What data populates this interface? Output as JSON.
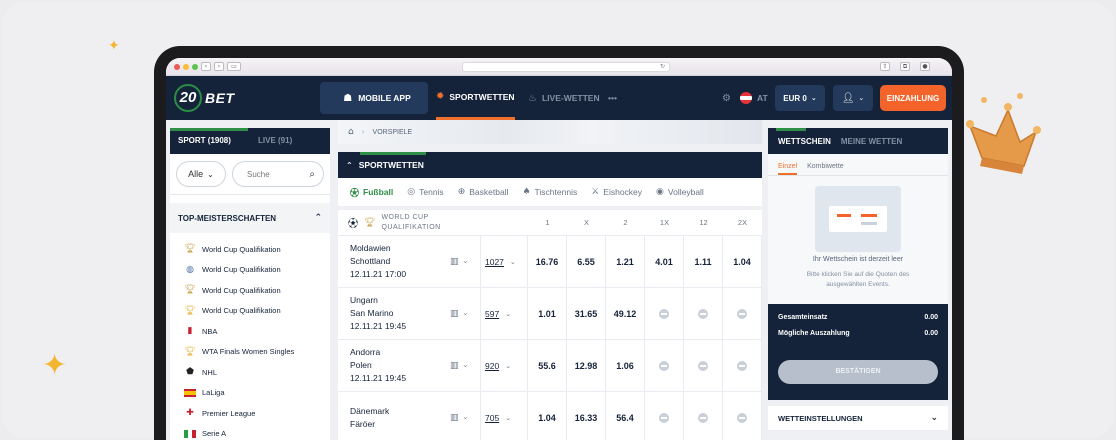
{
  "browser": {
    "url_icon": "reload-icon"
  },
  "nav": {
    "logo_number": "20",
    "logo_text": "BET",
    "mobile_app": "MOBILE APP",
    "sportwetten": "SPORTWETTEN",
    "live_wetten": "LIVE-WETTEN",
    "more": "•••",
    "country": "AT",
    "currency": "EUR 0",
    "deposit": "EINZAHLUNG",
    "colors": {
      "bg": "#142339",
      "accent": "#f0702b",
      "green": "#2f8f48"
    }
  },
  "left": {
    "tab_sport": "SPORT (1908)",
    "tab_live": "LIVE (91)",
    "filter_select": "Alle",
    "search_placeholder": "Suche",
    "section_title": "TOP-MEISTERSCHAFTEN",
    "competitions": [
      {
        "label": "World Cup Qualifikation",
        "icon": "trophy-icon"
      },
      {
        "label": "World Cup Qualifikation",
        "icon": "globe-icon"
      },
      {
        "label": "World Cup Qualifikation",
        "icon": "trophy-icon"
      },
      {
        "label": "World Cup Qualifikation",
        "icon": "trophy-icon"
      },
      {
        "label": "NBA",
        "icon": "nba-icon"
      },
      {
        "label": "WTA Finals Women Singles",
        "icon": "trophy-icon"
      },
      {
        "label": "NHL",
        "icon": "nhl-icon"
      },
      {
        "label": "LaLiga",
        "icon": "flag-spain-icon"
      },
      {
        "label": "Premier League",
        "icon": "flag-england-icon"
      },
      {
        "label": "Serie A",
        "icon": "flag-italy-icon"
      }
    ]
  },
  "main": {
    "breadcrumb": "VORSPIELE",
    "header": "SPORTWETTEN",
    "sports": [
      "Fußball",
      "Tennis",
      "Basketball",
      "Tischtennis",
      "Eishockey",
      "Volleyball"
    ],
    "league_line1": "WORLD CUP",
    "league_line2": "QUALIFIKATION",
    "columns": [
      "1",
      "X",
      "2",
      "1X",
      "12",
      "2X"
    ],
    "matches": [
      {
        "home": "Moldawien",
        "away": "Schottland",
        "date": "12.11.21 17:00",
        "markets": "1027",
        "odds": [
          "16.76",
          "6.55",
          "1.21",
          "4.01",
          "1.11",
          "1.04"
        ]
      },
      {
        "home": "Ungarn",
        "away": "San Marino",
        "date": "12.11.21 19:45",
        "markets": "597",
        "odds": [
          "1.01",
          "31.65",
          "49.12",
          "",
          "",
          ""
        ]
      },
      {
        "home": "Andorra",
        "away": "Polen",
        "date": "12.11.21 19:45",
        "markets": "920",
        "odds": [
          "55.6",
          "12.98",
          "1.06",
          "",
          "",
          ""
        ]
      },
      {
        "home": "Dänemark",
        "away": "Färöer",
        "date": "",
        "markets": "705",
        "odds": [
          "1.04",
          "16.33",
          "56.4",
          "",
          "",
          ""
        ]
      }
    ]
  },
  "betslip": {
    "tab_slip": "WETTSCHEIN",
    "tab_mybets": "MEINE WETTEN",
    "sub_single": "Einzel",
    "sub_combo": "Kombiwette",
    "empty_title": "Ihr Wettschein ist derzeit leer",
    "empty_sub": "Bitte klicken Sie auf die Quoten des ausgewählten Events.",
    "total_stake_label": "Gesamteinsatz",
    "total_stake_value": "0.00",
    "payout_label": "Mögliche Auszahlung",
    "payout_value": "0.00",
    "confirm": "BESTÄTIGEN",
    "settings": "WETTEINSTELLUNGEN"
  }
}
